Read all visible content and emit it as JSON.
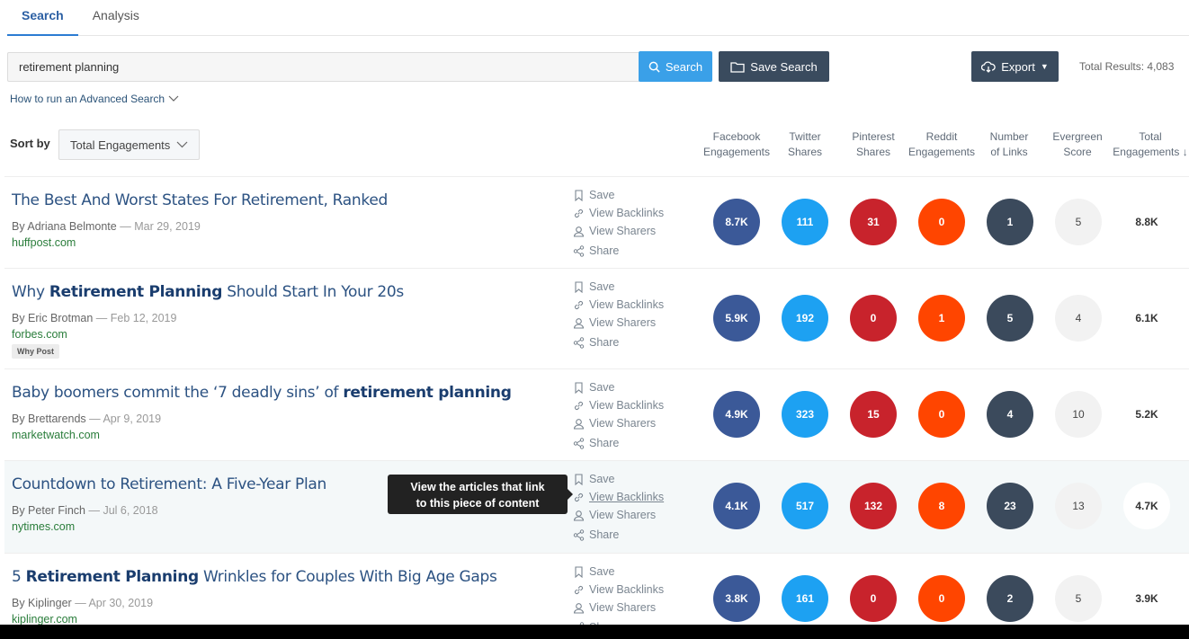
{
  "tabs": [
    {
      "label": "Search",
      "active": true
    },
    {
      "label": "Analysis",
      "active": false
    }
  ],
  "search": {
    "value": "retirement planning",
    "button_label": "Search",
    "save_label": "Save Search",
    "export_label": "Export",
    "total_results": "Total Results: 4,083"
  },
  "advanced_link": "How to run an Advanced Search",
  "sort": {
    "label": "Sort by",
    "value": "Total Engagements"
  },
  "columns": [
    {
      "line1": "Facebook",
      "line2": "Engagements"
    },
    {
      "line1": "Twitter",
      "line2": "Shares"
    },
    {
      "line1": "Pinterest",
      "line2": "Shares"
    },
    {
      "line1": "Reddit",
      "line2": "Engagements"
    },
    {
      "line1": "Number",
      "line2": "of Links"
    },
    {
      "line1": "Evergreen",
      "line2": "Score"
    },
    {
      "line1": "Total",
      "line2": "Engagements",
      "sort_indicator": "↓"
    }
  ],
  "actions": {
    "save": "Save",
    "backlinks": "View Backlinks",
    "sharers": "View Sharers",
    "share": "Share"
  },
  "results": [
    {
      "title_plain": "The Best And Worst States For Retirement, Ranked",
      "author": "By Adriana Belmonte",
      "date": "— Mar 29, 2019",
      "domain": "huffpost.com",
      "metrics": [
        "8.7K",
        "111",
        "31",
        "0",
        "1",
        "5",
        "8.8K"
      ]
    },
    {
      "title_pre": "Why ",
      "title_bold": "Retirement Planning",
      "title_post": " Should Start In Your 20s",
      "author": "By Eric Brotman",
      "date": "— Feb 12, 2019",
      "domain": "forbes.com",
      "tag": "Why Post",
      "metrics": [
        "5.9K",
        "192",
        "0",
        "1",
        "5",
        "4",
        "6.1K"
      ]
    },
    {
      "title_pre": "Baby boomers commit the ‘7 deadly sins’ of ",
      "title_bold": "retirement planning",
      "title_post": "",
      "author": "By Brettarends",
      "date": "— Apr 9, 2019",
      "domain": "marketwatch.com",
      "metrics": [
        "4.9K",
        "323",
        "15",
        "0",
        "4",
        "10",
        "5.2K"
      ]
    },
    {
      "title_plain": "Countdown to Retirement: A Five-Year Plan",
      "author": "By Peter Finch",
      "date": "— Jul 6, 2018",
      "domain": "nytimes.com",
      "metrics": [
        "4.1K",
        "517",
        "132",
        "8",
        "23",
        "13",
        "4.7K"
      ]
    },
    {
      "title_pre": "5 ",
      "title_bold": "Retirement Planning",
      "title_post": " Wrinkles for Couples With Big Age Gaps",
      "author": "By Kiplinger",
      "date": "— Apr 30, 2019",
      "domain": "kiplinger.com",
      "metrics": [
        "3.8K",
        "161",
        "0",
        "0",
        "2",
        "5",
        "3.9K"
      ]
    }
  ],
  "tooltip": {
    "line1": "View the articles that link",
    "line2": "to this piece of content"
  },
  "colors": {
    "facebook": "#3b5998",
    "twitter": "#1da1f2",
    "pinterest": "#c8232c",
    "reddit": "#ff4500",
    "links": "#3b4a5c",
    "evergreen": "#f2f2f2",
    "accent": "#3aa0e8",
    "dark_button": "#3a4b5e"
  }
}
